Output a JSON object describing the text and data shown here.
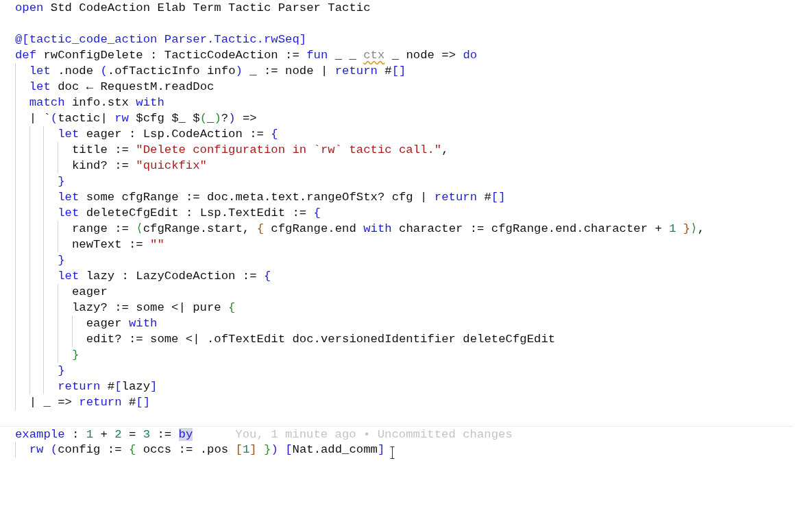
{
  "editor": {
    "lines": [
      {
        "kind": "code",
        "tokens": [
          {
            "text": "open",
            "kind": "keyword"
          },
          {
            "text": " Std CodeAction Elab Term Tactic Parser Tactic",
            "kind": "plain"
          }
        ]
      },
      {
        "kind": "blank"
      },
      {
        "kind": "code",
        "tokens": [
          {
            "text": "@[tactic_code_action Parser.Tactic.rwSeq]",
            "kind": "keyword"
          }
        ]
      },
      {
        "kind": "code",
        "tokens": [
          {
            "text": "def",
            "kind": "keyword"
          },
          {
            "text": " rwConfigDelete : TacticCodeAction := ",
            "kind": "plain"
          },
          {
            "text": "fun",
            "kind": "keyword"
          },
          {
            "text": " _ _ ",
            "kind": "plain"
          },
          {
            "text": "ctx",
            "kind": "unused"
          },
          {
            "text": " _ node => ",
            "kind": "plain"
          },
          {
            "text": "do",
            "kind": "keyword"
          }
        ]
      },
      {
        "kind": "code",
        "tokens": [
          {
            "text": "  let",
            "kind": "keyword"
          },
          {
            "text": " .node ",
            "kind": "plain"
          },
          {
            "text": "(",
            "kind": "bracket1"
          },
          {
            "text": ".ofTacticInfo info",
            "kind": "plain"
          },
          {
            "text": ")",
            "kind": "bracket1"
          },
          {
            "text": " _ := node | ",
            "kind": "plain"
          },
          {
            "text": "return",
            "kind": "keyword"
          },
          {
            "text": " #",
            "kind": "plain"
          },
          {
            "text": "[]",
            "kind": "bracket1"
          }
        ]
      },
      {
        "kind": "code",
        "tokens": [
          {
            "text": "  let",
            "kind": "keyword"
          },
          {
            "text": " doc ← RequestM.readDoc",
            "kind": "plain"
          }
        ]
      },
      {
        "kind": "code",
        "tokens": [
          {
            "text": "  match",
            "kind": "keyword"
          },
          {
            "text": " info.stx ",
            "kind": "plain"
          },
          {
            "text": "with",
            "kind": "keyword"
          }
        ]
      },
      {
        "kind": "code",
        "tokens": [
          {
            "text": "  | `",
            "kind": "plain"
          },
          {
            "text": "(",
            "kind": "bracket1"
          },
          {
            "text": "tactic| ",
            "kind": "plain"
          },
          {
            "text": "rw",
            "kind": "keyword"
          },
          {
            "text": " $cfg $_ $",
            "kind": "plain"
          },
          {
            "text": "(",
            "kind": "bracket2"
          },
          {
            "text": "_",
            "kind": "plain"
          },
          {
            "text": ")",
            "kind": "bracket2"
          },
          {
            "text": "?",
            "kind": "plain"
          },
          {
            "text": ")",
            "kind": "bracket1"
          },
          {
            "text": " =>",
            "kind": "plain"
          }
        ]
      },
      {
        "kind": "code",
        "tokens": [
          {
            "text": "      let",
            "kind": "keyword"
          },
          {
            "text": " eager : Lsp.CodeAction := ",
            "kind": "plain"
          },
          {
            "text": "{",
            "kind": "bracket1"
          }
        ]
      },
      {
        "kind": "code",
        "tokens": [
          {
            "text": "        title := ",
            "kind": "plain"
          },
          {
            "text": "\"Delete configuration in `rw` tactic call.\"",
            "kind": "string"
          },
          {
            "text": ",",
            "kind": "plain"
          }
        ]
      },
      {
        "kind": "code",
        "tokens": [
          {
            "text": "        kind? := ",
            "kind": "plain"
          },
          {
            "text": "\"quickfix\"",
            "kind": "string"
          }
        ]
      },
      {
        "kind": "code",
        "tokens": [
          {
            "text": "      }",
            "kind": "bracket1"
          }
        ]
      },
      {
        "kind": "code",
        "tokens": [
          {
            "text": "      let",
            "kind": "keyword"
          },
          {
            "text": " some cfgRange := doc.meta.text.rangeOfStx? cfg | ",
            "kind": "plain"
          },
          {
            "text": "return",
            "kind": "keyword"
          },
          {
            "text": " #",
            "kind": "plain"
          },
          {
            "text": "[]",
            "kind": "bracket1"
          }
        ]
      },
      {
        "kind": "code",
        "tokens": [
          {
            "text": "      let",
            "kind": "keyword"
          },
          {
            "text": " deleteCfgEdit : Lsp.TextEdit := ",
            "kind": "plain"
          },
          {
            "text": "{",
            "kind": "bracket1"
          }
        ]
      },
      {
        "kind": "code",
        "tokens": [
          {
            "text": "        range := ",
            "kind": "plain"
          },
          {
            "text": "⟨",
            "kind": "bracket2"
          },
          {
            "text": "cfgRange.start, ",
            "kind": "plain"
          },
          {
            "text": "{",
            "kind": "bracket3"
          },
          {
            "text": " cfgRange.end ",
            "kind": "plain"
          },
          {
            "text": "with",
            "kind": "keyword"
          },
          {
            "text": " character := cfgRange.end.character + ",
            "kind": "plain"
          },
          {
            "text": "1",
            "kind": "number"
          },
          {
            "text": " }",
            "kind": "bracket3"
          },
          {
            "text": "⟩",
            "kind": "bracket2"
          },
          {
            "text": ",",
            "kind": "plain"
          }
        ]
      },
      {
        "kind": "code",
        "tokens": [
          {
            "text": "        newText := ",
            "kind": "plain"
          },
          {
            "text": "\"\"",
            "kind": "string"
          }
        ]
      },
      {
        "kind": "code",
        "tokens": [
          {
            "text": "      }",
            "kind": "bracket1"
          }
        ]
      },
      {
        "kind": "code",
        "tokens": [
          {
            "text": "      let",
            "kind": "keyword"
          },
          {
            "text": " lazy : LazyCodeAction := ",
            "kind": "plain"
          },
          {
            "text": "{",
            "kind": "bracket1"
          }
        ]
      },
      {
        "kind": "code",
        "tokens": [
          {
            "text": "        eager",
            "kind": "plain"
          }
        ]
      },
      {
        "kind": "code",
        "tokens": [
          {
            "text": "        lazy? := some <| pure ",
            "kind": "plain"
          },
          {
            "text": "{",
            "kind": "bracket2"
          }
        ]
      },
      {
        "kind": "code",
        "tokens": [
          {
            "text": "          eager ",
            "kind": "plain"
          },
          {
            "text": "with",
            "kind": "keyword"
          }
        ]
      },
      {
        "kind": "code",
        "tokens": [
          {
            "text": "          edit? := some <| .ofTextEdit doc.versionedIdentifier deleteCfgEdit",
            "kind": "plain"
          }
        ]
      },
      {
        "kind": "code",
        "tokens": [
          {
            "text": "        }",
            "kind": "bracket2"
          }
        ]
      },
      {
        "kind": "code",
        "tokens": [
          {
            "text": "      }",
            "kind": "bracket1"
          }
        ]
      },
      {
        "kind": "code",
        "tokens": [
          {
            "text": "      return",
            "kind": "keyword"
          },
          {
            "text": " #",
            "kind": "plain"
          },
          {
            "text": "[",
            "kind": "bracket1"
          },
          {
            "text": "lazy",
            "kind": "plain"
          },
          {
            "text": "]",
            "kind": "bracket1"
          }
        ]
      },
      {
        "kind": "code",
        "tokens": [
          {
            "text": "  | _ => ",
            "kind": "plain"
          },
          {
            "text": "return",
            "kind": "keyword"
          },
          {
            "text": " #",
            "kind": "plain"
          },
          {
            "text": "[]",
            "kind": "bracket1"
          }
        ]
      },
      {
        "kind": "blank"
      },
      {
        "kind": "code",
        "current": true,
        "annotation": "You, 1 minute ago • Uncommitted changes",
        "tokens": [
          {
            "text": "example",
            "kind": "keyword"
          },
          {
            "text": " : ",
            "kind": "plain"
          },
          {
            "text": "1",
            "kind": "number"
          },
          {
            "text": " + ",
            "kind": "plain"
          },
          {
            "text": "2",
            "kind": "number"
          },
          {
            "text": " = ",
            "kind": "plain"
          },
          {
            "text": "3",
            "kind": "number"
          },
          {
            "text": " := ",
            "kind": "plain"
          },
          {
            "text": "by",
            "kind": "keyword",
            "highlighted": true
          }
        ]
      },
      {
        "kind": "code",
        "tokens": [
          {
            "text": "  rw",
            "kind": "keyword"
          },
          {
            "text": " (",
            "kind": "bracket1"
          },
          {
            "text": "config := ",
            "kind": "plain"
          },
          {
            "text": "{",
            "kind": "bracket2"
          },
          {
            "text": " occs := .pos ",
            "kind": "plain"
          },
          {
            "text": "[",
            "kind": "bracket3"
          },
          {
            "text": "1",
            "kind": "number"
          },
          {
            "text": "]",
            "kind": "bracket3"
          },
          {
            "text": " }",
            "kind": "bracket2"
          },
          {
            "text": ")",
            "kind": "bracket1"
          },
          {
            "text": " [",
            "kind": "bracket1"
          },
          {
            "text": "Nat.add_comm",
            "kind": "plain"
          },
          {
            "text": "]",
            "kind": "bracket1"
          }
        ]
      }
    ]
  }
}
